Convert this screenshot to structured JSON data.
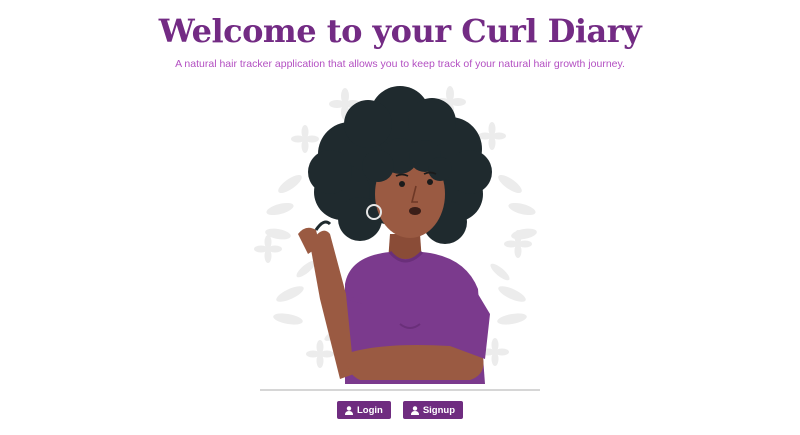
{
  "header": {
    "title": "Welcome to your Curl Diary",
    "subtitle": "A natural hair tracker application that allows you to keep track of your natural hair growth journey."
  },
  "illustration": {
    "name": "woman-with-curly-hair-illustration"
  },
  "actions": {
    "login_label": "Login",
    "signup_label": "Signup",
    "login_icon": "user-icon",
    "signup_icon": "user-icon"
  },
  "colors": {
    "title": "#732b84",
    "subtitle": "#b34fc2",
    "button_bg": "#6f2c80",
    "button_text": "#ffffff",
    "shirt": "#7b3a8d",
    "skin": "#9a5a42",
    "hair": "#1f2a2e",
    "leaf": "#ececec"
  }
}
